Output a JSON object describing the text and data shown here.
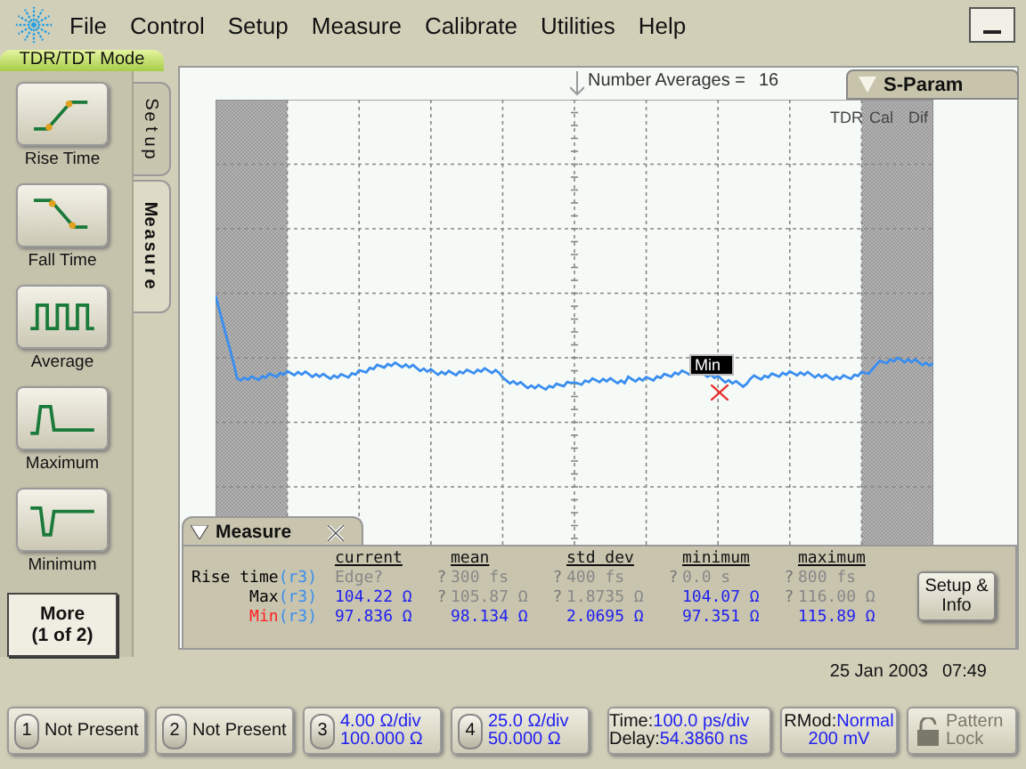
{
  "menu": {
    "items": [
      "File",
      "Control",
      "Setup",
      "Measure",
      "Calibrate",
      "Utilities",
      "Help"
    ]
  },
  "mode_label": "TDR/TDT Mode",
  "side_tabs": [
    {
      "label": "Setup",
      "selected": false
    },
    {
      "label": "Measure",
      "selected": true
    }
  ],
  "measure_buttons": [
    {
      "label": "Rise Time",
      "kind": "rise"
    },
    {
      "label": "Fall Time",
      "kind": "fall"
    },
    {
      "label": "Average",
      "kind": "average"
    },
    {
      "label": "Maximum",
      "kind": "maximum"
    },
    {
      "label": "Minimum",
      "kind": "minimum"
    }
  ],
  "more_button": {
    "line1": "More",
    "line2": "(1 of 2)"
  },
  "display": {
    "averages_label": "Number Averages =",
    "averages_value": "16",
    "sparam_tab": "S-Param",
    "overlay_labels": [
      "TDR",
      "Cal",
      "Dif"
    ],
    "marker_label": "Min"
  },
  "measure_panel": {
    "title": "Measure",
    "columns": [
      "current",
      "mean",
      "std dev",
      "minimum",
      "maximum"
    ],
    "rows": [
      {
        "name": "Rise time",
        "source": "(r3)",
        "color": "#000000",
        "cells": [
          {
            "value": "Edge?",
            "valid": false
          },
          {
            "mark": "?",
            "value": "300 fs",
            "valid": false
          },
          {
            "mark": "?",
            "value": "400 fs",
            "valid": false
          },
          {
            "mark": "?",
            "value": "0.0 s",
            "valid": false
          },
          {
            "mark": "?",
            "value": "800 fs",
            "valid": false
          }
        ]
      },
      {
        "name": "Max",
        "source": "(r3)",
        "color": "#000000",
        "cells": [
          {
            "value": "104.22 Ω",
            "valid": true
          },
          {
            "mark": "?",
            "value": "105.87 Ω",
            "valid": false
          },
          {
            "mark": "?",
            "value": "1.8735 Ω",
            "valid": false
          },
          {
            "value": "104.07 Ω",
            "valid": true
          },
          {
            "mark": "?",
            "value": "116.00 Ω",
            "valid": false
          }
        ]
      },
      {
        "name": "Min",
        "source": "(r3)",
        "color": "#ff2020",
        "cells": [
          {
            "value": "97.836 Ω",
            "valid": true
          },
          {
            "value": "98.134 Ω",
            "valid": true
          },
          {
            "value": "2.0695 Ω",
            "valid": true
          },
          {
            "value": "97.351 Ω",
            "valid": true
          },
          {
            "value": "115.89 Ω",
            "valid": true
          }
        ]
      }
    ],
    "setup_button": "Setup & Info"
  },
  "status": {
    "date": "25 Jan 2003",
    "time": "07:49"
  },
  "channels": [
    {
      "number": "1",
      "present": false,
      "lines": [
        "Not Present"
      ]
    },
    {
      "number": "2",
      "present": false,
      "lines": [
        "Not Present"
      ]
    },
    {
      "number": "3",
      "present": true,
      "lines": [
        "4.00 Ω/div",
        "100.000 Ω"
      ]
    },
    {
      "number": "4",
      "present": true,
      "lines": [
        "25.0 Ω/div",
        "50.000 Ω"
      ]
    }
  ],
  "timebase": [
    {
      "label": "Time:",
      "value": "100.0 ps/div"
    },
    {
      "label": "Delay:",
      "value": "54.3860 ns"
    }
  ],
  "rmod": [
    {
      "label": "RMod:",
      "value": "Normal"
    },
    {
      "value": "200 mV"
    }
  ],
  "pattern_lock": {
    "label": "Pattern Lock",
    "disabled": true
  }
}
